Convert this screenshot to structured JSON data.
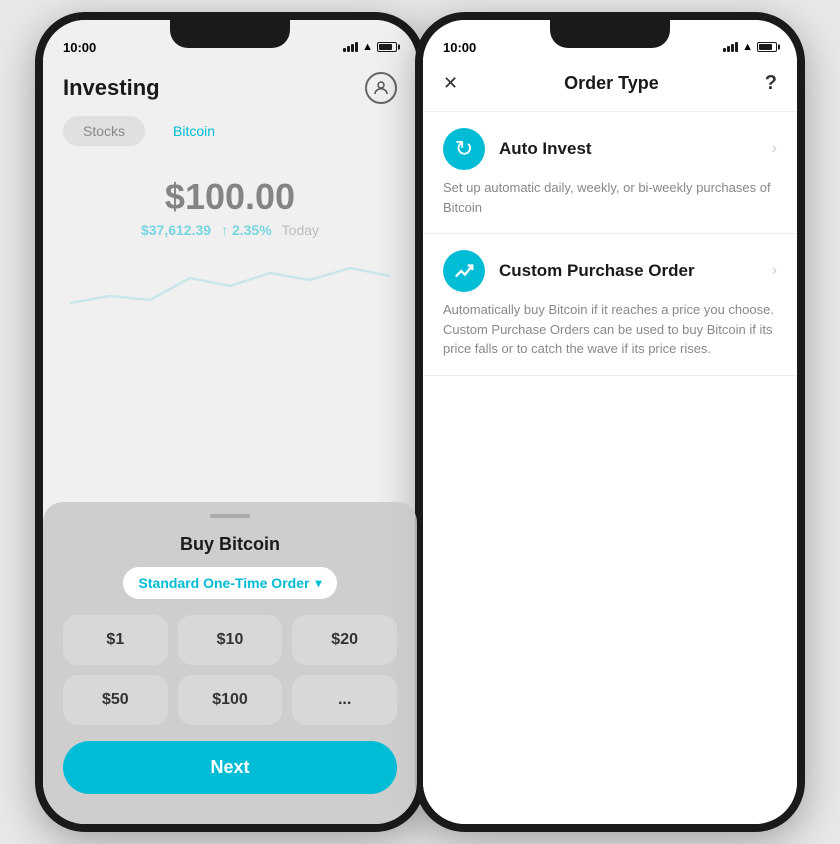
{
  "left_phone": {
    "status": {
      "time": "10:00"
    },
    "header": {
      "title": "Investing",
      "profile_icon": "👤"
    },
    "tabs": [
      {
        "label": "Stocks",
        "active": false
      },
      {
        "label": "Bitcoin",
        "active": true
      }
    ],
    "price": {
      "main": "$100.00",
      "btc": "$37,612.39",
      "change": "↑ 2.35%",
      "period": "Today"
    },
    "modal": {
      "title": "Buy Bitcoin",
      "order_type": "Standard One-Time Order",
      "amounts": [
        "$1",
        "$10",
        "$20",
        "$50",
        "$100",
        "..."
      ],
      "next_label": "Next"
    }
  },
  "right_phone": {
    "status": {
      "time": "10:00"
    },
    "header": {
      "close": "✕",
      "title": "Order Type",
      "help": "?"
    },
    "order_types": [
      {
        "name": "Auto Invest",
        "icon": "↻",
        "description": "Set up automatic daily, weekly, or bi-weekly purchases of Bitcoin"
      },
      {
        "name": "Custom Purchase Order",
        "icon": "↗",
        "description": "Automatically buy Bitcoin if it reaches a price you choose. Custom Purchase Orders can be used to buy Bitcoin if its price falls or to catch the wave if its price rises."
      }
    ]
  }
}
